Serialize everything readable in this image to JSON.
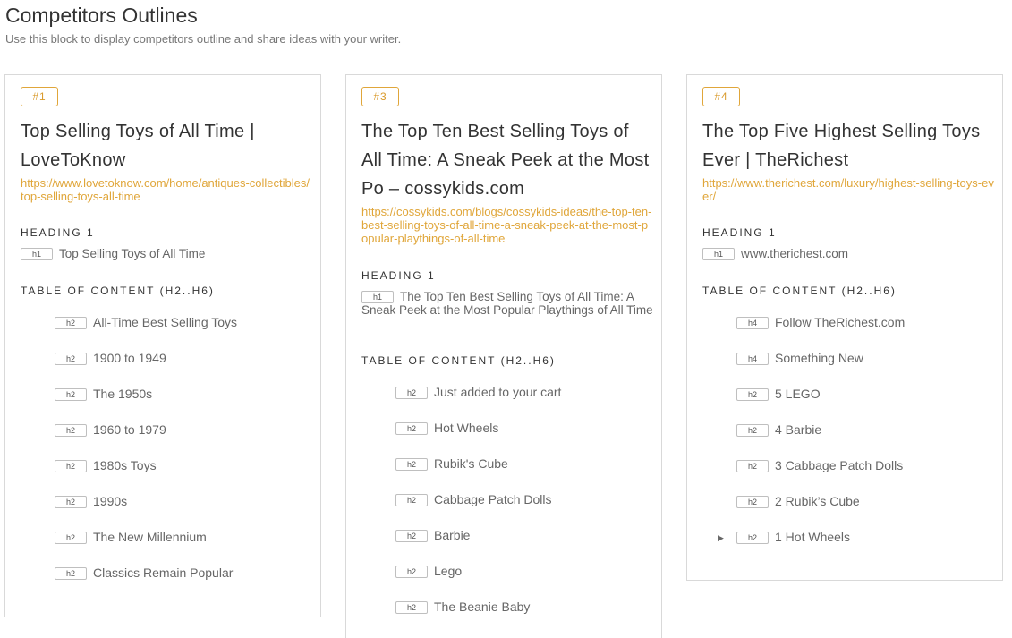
{
  "header": {
    "title": "Competitors Outlines",
    "subtitle": "Use this block to display competitors outline and share ideas with your writer."
  },
  "section_labels": {
    "heading1": "HEADING 1",
    "toc": "TABLE OF CONTENT (H2..H6)"
  },
  "cards": [
    {
      "badge": "#1",
      "title": "Top Selling Toys of All Time | LoveToKnow",
      "url": "https://www.lovetoknow.com/home/antiques-collectibles/top-selling-toys-all-time",
      "h1": {
        "tag": "h1",
        "text": "Top Selling Toys of All Time"
      },
      "toc": [
        {
          "tag": "h2",
          "text": "All-Time Best Selling Toys"
        },
        {
          "tag": "h2",
          "text": "1900 to 1949"
        },
        {
          "tag": "h2",
          "text": "The 1950s"
        },
        {
          "tag": "h2",
          "text": "1960 to 1979"
        },
        {
          "tag": "h2",
          "text": "1980s Toys"
        },
        {
          "tag": "h2",
          "text": "1990s"
        },
        {
          "tag": "h2",
          "text": "The New Millennium"
        },
        {
          "tag": "h2",
          "text": "Classics Remain Popular"
        }
      ]
    },
    {
      "badge": "#3",
      "title": "The Top Ten Best Selling Toys of All Time: A Sneak Peek at the Most Po – cossykids.com",
      "url": "https://cossykids.com/blogs/cossykids-ideas/the-top-ten-best-selling-toys-of-all-time-a-sneak-peek-at-the-most-popular-playthings-of-all-time",
      "h1": {
        "tag": "h1",
        "text": "The Top Ten Best Selling Toys of All Time: A Sneak Peek at the Most Popular Playthings of All Time"
      },
      "toc": [
        {
          "tag": "h2",
          "text": "Just added to your cart"
        },
        {
          "tag": "h2",
          "text": "Hot Wheels"
        },
        {
          "tag": "h2",
          "text": "Rubik's Cube"
        },
        {
          "tag": "h2",
          "text": "Cabbage Patch Dolls"
        },
        {
          "tag": "h2",
          "text": "Barbie"
        },
        {
          "tag": "h2",
          "text": "Lego"
        },
        {
          "tag": "h2",
          "text": "The Beanie Baby"
        }
      ]
    },
    {
      "badge": "#4",
      "title": "The Top Five Highest Selling Toys Ever | TheRichest",
      "url": "https://www.therichest.com/luxury/highest-selling-toys-ever/",
      "h1": {
        "tag": "h1",
        "text": "www.therichest.com"
      },
      "toc": [
        {
          "tag": "h4",
          "text": "Follow TheRichest.com"
        },
        {
          "tag": "h4",
          "text": "Something New"
        },
        {
          "tag": "h2",
          "text": "5 LEGO"
        },
        {
          "tag": "h2",
          "text": "4 Barbie"
        },
        {
          "tag": "h2",
          "text": "3 Cabbage Patch Dolls"
        },
        {
          "tag": "h2",
          "text": "2 Rubik’s Cube"
        },
        {
          "tag": "h2",
          "text": "1 Hot Wheels",
          "expandable": true
        }
      ]
    }
  ],
  "icons": {
    "expand": "caret-right-icon"
  },
  "colors": {
    "accent": "#e0a63a",
    "border": "#d9d9d9",
    "text": "#666666"
  }
}
